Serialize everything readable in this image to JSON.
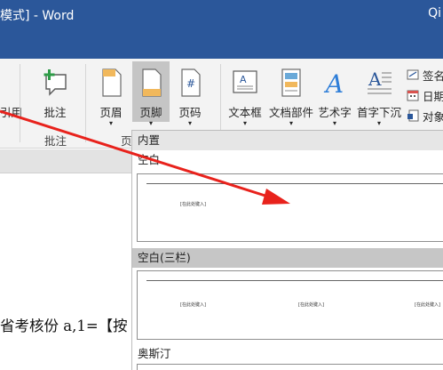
{
  "window": {
    "title": "模式] - Word",
    "user": "Qi"
  },
  "ribbon": {
    "partial_button_label": "引用",
    "comment": {
      "label": "批注",
      "group": "批注"
    },
    "header_footer": {
      "header_label": "页眉",
      "footer_label": "页脚",
      "page_number_label": "页码",
      "group": "页"
    },
    "text_group": {
      "textbox_label": "文本框",
      "quickparts_label": "文档部件",
      "wordart_label": "艺术字",
      "dropcap_label": "首字下沉",
      "small_items": [
        "签名",
        "日期",
        "对象"
      ]
    }
  },
  "gallery": {
    "builtin_header": "内置",
    "sections": [
      {
        "name": "空白",
        "placeholders": [
          "[在此处键入]"
        ]
      },
      {
        "name": "空白(三栏)",
        "placeholders": [
          "[在此处键入]",
          "[在此处键入]",
          "[在此处键入]"
        ]
      },
      {
        "name": "奥斯汀"
      }
    ]
  },
  "document": {
    "text": "省考核份 a,1=【按"
  },
  "colors": {
    "titlebar": "#2b579a",
    "arrow": "#e8221c",
    "selected_section": "#c6c6c6"
  }
}
